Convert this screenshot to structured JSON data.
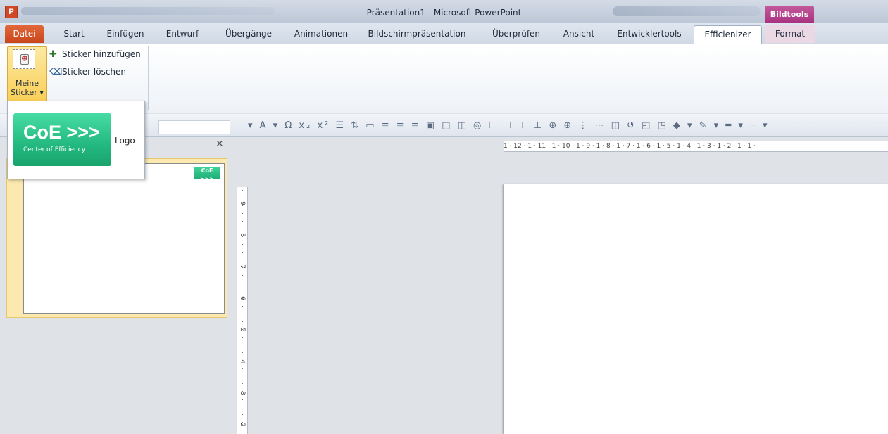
{
  "window": {
    "title": "Präsentation1 - Microsoft PowerPoint",
    "contextual_tab_group": "Bildtools",
    "app_icon_letter": "P"
  },
  "tabs": [
    {
      "label": "Datei"
    },
    {
      "label": "Start"
    },
    {
      "label": "Einfügen"
    },
    {
      "label": "Entwurf"
    },
    {
      "label": "Übergänge"
    },
    {
      "label": "Animationen"
    },
    {
      "label": "Bildschirmpräsentation"
    },
    {
      "label": "Überprüfen"
    },
    {
      "label": "Ansicht"
    },
    {
      "label": "Entwicklertools"
    },
    {
      "label": "Efficienizer"
    },
    {
      "label": "Format"
    }
  ],
  "ribbon": {
    "meine_sticker_line1": "Meine",
    "meine_sticker_line2": "Sticker ▾",
    "add_sticker": "Sticker hinzufügen",
    "delete_sticker": "Sticker löschen"
  },
  "dropdown": {
    "logo_text": "CoE >>>",
    "logo_subtitle": "Center of Efficiency",
    "item_label": "Logo"
  },
  "thumbnail": {
    "mini_logo_text": "CoE >>>",
    "mini_logo_sub": "Center of Efficiency"
  },
  "ruler_top": "1 · 12 · 1 · 11 · 1 · 10 · 1 · 9 · 1 · 8 · 1 · 7 · 1 · 6 · 1 · 5 · 1 · 4 · 1 · 3 · 1 · 2 · 1 · 1 ·",
  "ruler_left": [
    "9",
    "8",
    "7",
    "6",
    "5",
    "4",
    "3",
    "2"
  ],
  "colors": {
    "file_tab": "#d24726",
    "contextual_tab": "#a8317f",
    "logo_green": "#23b97f",
    "selection_yellow": "#f9cf58"
  }
}
